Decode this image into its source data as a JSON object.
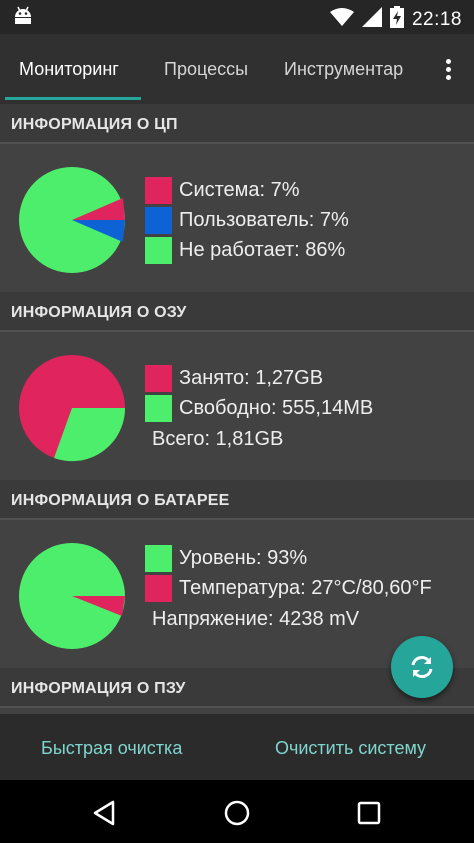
{
  "status_bar": {
    "time": "22:18",
    "icons": [
      "android-icon",
      "wifi-icon",
      "signal-icon",
      "battery-charging-icon"
    ]
  },
  "tabs": [
    {
      "label": "Мониторинг",
      "active": true
    },
    {
      "label": "Процессы",
      "active": false
    },
    {
      "label": "Инструментар",
      "active": false
    }
  ],
  "sections": {
    "cpu": {
      "title": "ИНФОРМАЦИЯ О ЦП",
      "legend": [
        {
          "label": "Система: 7%",
          "color": "#e0245e",
          "value": 7
        },
        {
          "label": "Пользователь: 7%",
          "color": "#0d62d6",
          "value": 7
        },
        {
          "label": "Не работает: 86%",
          "color": "#4cee6c",
          "value": 86
        }
      ]
    },
    "ram": {
      "title": "ИНФОРМАЦИЯ О ОЗУ",
      "legend": [
        {
          "label": "Занято: 1,27GB",
          "color": "#e0245e",
          "value": 70
        },
        {
          "label": "Свободно: 555,14MB",
          "color": "#4cee6c",
          "value": 30
        }
      ],
      "total": "Всего: 1,81GB"
    },
    "battery": {
      "title": "ИНФОРМАЦИЯ О БАТАРЕЕ",
      "legend": [
        {
          "label": "Уровень: 93%",
          "color": "#4cee6c",
          "value": 93
        },
        {
          "label": "Температура: 27°C/80,60°F",
          "color": "#e0245e",
          "value": 7
        }
      ],
      "voltage": "Напряжение: 4238 mV"
    },
    "rom": {
      "title": "ИНФОРМАЦИЯ О ПЗУ"
    }
  },
  "bottom_bar": {
    "quick_clean": "Быстрая очистка",
    "clean_system": "Очистить систему"
  },
  "colors": {
    "accent": "#26a69a",
    "red": "#e0245e",
    "green": "#4cee6c",
    "blue": "#0d62d6"
  }
}
